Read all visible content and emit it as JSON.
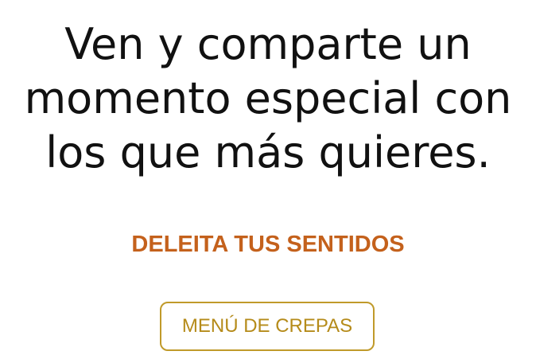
{
  "hero": {
    "headline_lines": [
      "Ven y comparte un",
      "momento especial con",
      "los que más quieres."
    ]
  },
  "subheading": "DELEITA TUS SENTIDOS",
  "menu_button": {
    "label": "MENÚ DE CREPAS"
  },
  "colors": {
    "headline": "#111111",
    "subheading": "#c4611c",
    "button_border": "#c09a2a",
    "button_text": "#b58b1a",
    "background": "#ffffff"
  }
}
